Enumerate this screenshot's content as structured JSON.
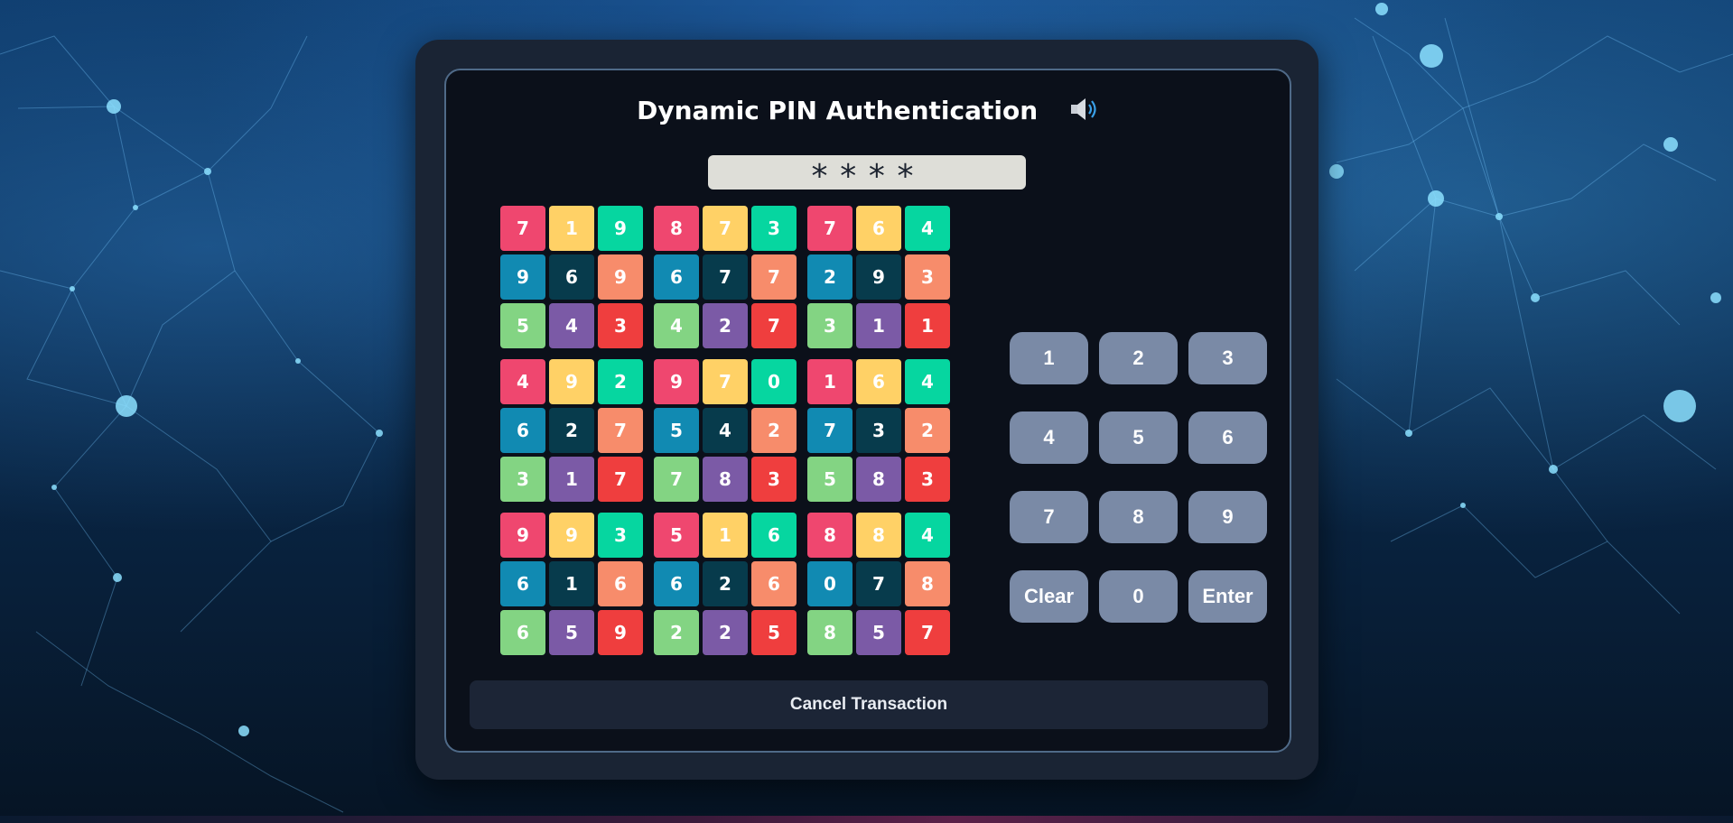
{
  "header": {
    "title": "Dynamic PIN Authentication",
    "speaker_icon": "speaker-volume-icon"
  },
  "pin_display": {
    "value": "****"
  },
  "grid": {
    "colors": [
      "#ef476f",
      "#ffd166",
      "#06d6a0",
      "#118ab2",
      "#073b4c",
      "#f78c6b",
      "#83d483",
      "#7b5aa6",
      "#ef3e3e"
    ],
    "blocks": [
      [
        "7",
        "1",
        "9",
        "9",
        "6",
        "9",
        "5",
        "4",
        "3"
      ],
      [
        "8",
        "7",
        "3",
        "6",
        "7",
        "7",
        "4",
        "2",
        "7"
      ],
      [
        "7",
        "6",
        "4",
        "2",
        "9",
        "3",
        "3",
        "1",
        "1"
      ],
      [
        "4",
        "9",
        "2",
        "6",
        "2",
        "7",
        "3",
        "1",
        "7"
      ],
      [
        "9",
        "7",
        "0",
        "5",
        "4",
        "2",
        "7",
        "8",
        "3"
      ],
      [
        "1",
        "6",
        "4",
        "7",
        "3",
        "2",
        "5",
        "8",
        "3"
      ],
      [
        "9",
        "9",
        "3",
        "6",
        "1",
        "6",
        "6",
        "5",
        "9"
      ],
      [
        "5",
        "1",
        "6",
        "6",
        "2",
        "6",
        "2",
        "2",
        "5"
      ],
      [
        "8",
        "8",
        "4",
        "0",
        "7",
        "8",
        "8",
        "5",
        "7"
      ]
    ]
  },
  "keypad": {
    "keys": [
      "1",
      "2",
      "3",
      "4",
      "5",
      "6",
      "7",
      "8",
      "9",
      "Clear",
      "0",
      "Enter"
    ]
  },
  "footer": {
    "cancel_label": "Cancel Transaction"
  }
}
